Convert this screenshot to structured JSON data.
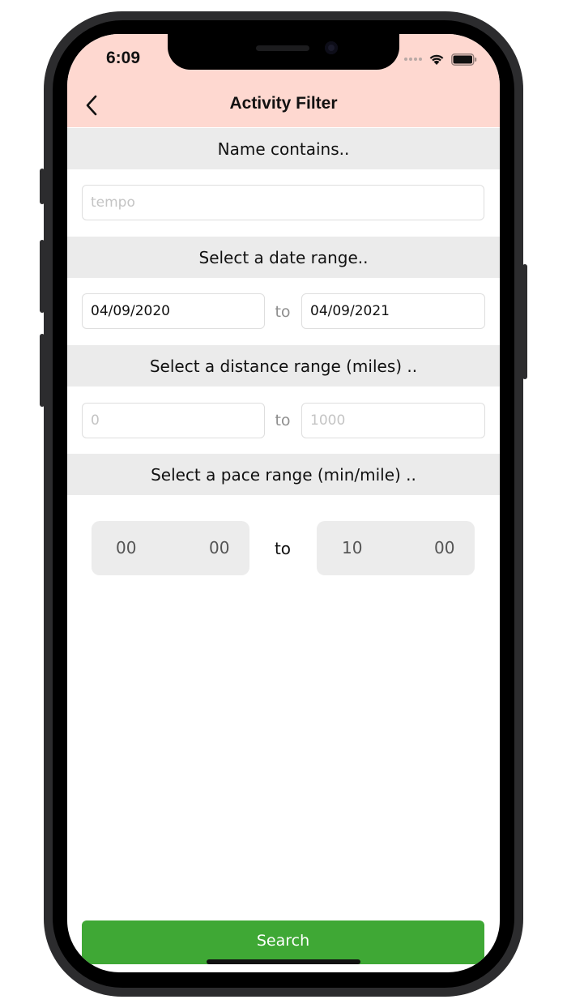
{
  "status_bar": {
    "time": "6:09",
    "icons": [
      "cellular-signal-icon",
      "wifi-icon",
      "battery-icon"
    ]
  },
  "nav": {
    "title": "Activity Filter",
    "back_icon": "chevron-left-icon"
  },
  "name_section": {
    "header": "Name contains..",
    "input_value": "",
    "input_placeholder": "tempo"
  },
  "date_section": {
    "header": "Select a date range..",
    "from_value": "04/09/2020",
    "to_label": "to",
    "to_value": "04/09/2021"
  },
  "distance_section": {
    "header": "Select a distance range (miles) ..",
    "from_value": "",
    "from_placeholder": "0",
    "to_label": "to",
    "to_value": "",
    "to_placeholder": "1000"
  },
  "pace_section": {
    "header": "Select a pace range (min/mile) ..",
    "from_minutes": "00",
    "from_seconds": "00",
    "to_label": "to",
    "to_minutes": "10",
    "to_seconds": "00"
  },
  "search": {
    "label": "Search"
  },
  "colors": {
    "header_bg": "#fed8d0",
    "section_bg": "#ebebeb",
    "search_button": "#3fa835"
  }
}
